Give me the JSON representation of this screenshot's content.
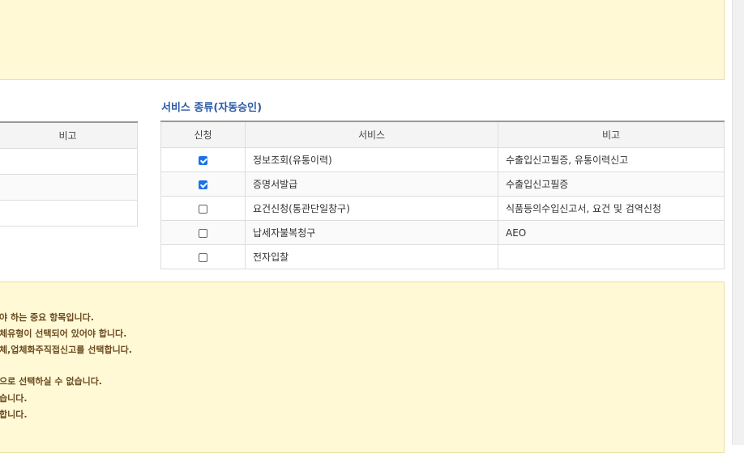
{
  "left_table": {
    "header": "비고",
    "rows": [
      "",
      "",
      ""
    ]
  },
  "service_section": {
    "title": "서비스 종류(자동승인)",
    "columns": [
      "신청",
      "서비스",
      "비고"
    ],
    "rows": [
      {
        "checked": true,
        "service": "정보조회(유통이력)",
        "note": "수출입신고필증, 유통이력신고"
      },
      {
        "checked": true,
        "service": "증명서발급",
        "note": "수출입신고필증"
      },
      {
        "checked": false,
        "service": "요건신청(통관단일창구)",
        "note": "식품등의수입신고서, 요건 및 검역신청"
      },
      {
        "checked": false,
        "service": "납세자불복청구",
        "note": "AEO"
      },
      {
        "checked": false,
        "service": "전자입찰",
        "note": ""
      }
    ]
  },
  "notice": {
    "lines": [
      "야 하는 중요 항목입니다.",
      "체유형이 선택되어 있어야 합니다.",
      "체,업체화주직접신고를 선택합니다.",
      "",
      "으로 선택하실 수 없습니다.",
      "습니다.",
      "합니다."
    ]
  },
  "colors": {
    "accent": "#2a5aa7",
    "checkbox": "#1a73e8",
    "notice_bg": "#fff9d6",
    "notice_text": "#6b4a1f"
  }
}
